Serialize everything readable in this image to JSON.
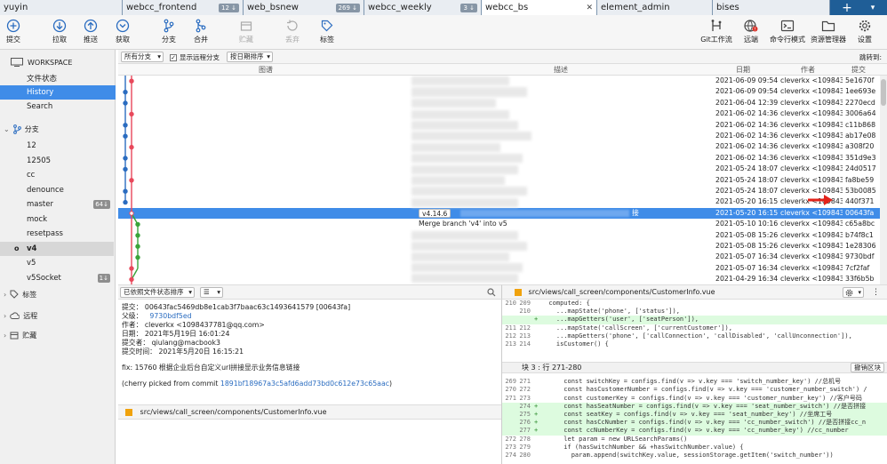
{
  "tabs": [
    {
      "label": "yuyin",
      "badge": "",
      "active": false
    },
    {
      "label": "webcc_frontend",
      "badge": "12 ↓",
      "active": false
    },
    {
      "label": "web_bsnew",
      "badge": "269 ↓",
      "active": false
    },
    {
      "label": "webcc_weekly",
      "badge": "3 ↓",
      "active": false
    },
    {
      "label": "webcc_bs",
      "badge": "",
      "active": true,
      "close": "✕"
    },
    {
      "label": "element_admin",
      "badge": "",
      "active": false
    },
    {
      "label": "bises",
      "badge": "",
      "active": false
    }
  ],
  "tab_plus": "+",
  "tab_menu": "▾",
  "toolbar": {
    "commit": "提交",
    "pull": "拉取",
    "push": "推送",
    "fetch": "获取",
    "branch": "分支",
    "merge": "合并",
    "stash": "贮藏",
    "discard": "丢弃",
    "tag": "标签",
    "gitflow": "Git工作流",
    "remote": "远端",
    "terminal": "命令行模式",
    "explorer": "资源管理器",
    "settings": "设置"
  },
  "sidebar": {
    "workspace": "WORKSPACE",
    "items": [
      "文件状态",
      "History",
      "Search"
    ],
    "branches_header": "分支",
    "branches": [
      {
        "name": "12",
        "count": ""
      },
      {
        "name": "12505",
        "count": ""
      },
      {
        "name": "cc",
        "count": ""
      },
      {
        "name": "denounce",
        "count": ""
      },
      {
        "name": "master",
        "count": "64↓"
      },
      {
        "name": "mock",
        "count": ""
      },
      {
        "name": "resetpass",
        "count": ""
      },
      {
        "name": "v4",
        "count": "",
        "current": true
      },
      {
        "name": "v5",
        "count": ""
      },
      {
        "name": "v5Socket",
        "count": "1↓"
      }
    ],
    "tags": "标签",
    "remotes": "远程",
    "stashes": "贮藏"
  },
  "filter": {
    "all_branches": "所有分支",
    "show_remote": "显示远程分支",
    "sort": "按日期排序",
    "jump": "跳转到:"
  },
  "columns": {
    "graph": "图谱",
    "desc": "描述",
    "date": "日期",
    "author": "作者",
    "commit": "提交"
  },
  "commits": [
    {
      "date": "2021-06-09 09:54",
      "author": "cleverkx <109843",
      "hash": "5e1670f"
    },
    {
      "date": "2021-06-09 09:54",
      "author": "cleverkx <109843",
      "hash": "1ee693e"
    },
    {
      "date": "2021-06-04 12:39",
      "author": "cleverkx <109843",
      "hash": "2270ecd"
    },
    {
      "date": "2021-06-02 14:36",
      "author": "cleverkx <109843",
      "hash": "3006a64"
    },
    {
      "date": "2021-06-02 14:36",
      "author": "cleverkx <109843",
      "hash": "c11b868"
    },
    {
      "date": "2021-06-02 14:36",
      "author": "cleverkx <109843",
      "hash": "ab17e08"
    },
    {
      "date": "2021-06-02 14:36",
      "author": "cleverkx <109843",
      "hash": "a308f20"
    },
    {
      "date": "2021-06-02 14:36",
      "author": "cleverkx <109843",
      "hash": "351d9e3"
    },
    {
      "date": "2021-05-24 18:07",
      "author": "cleverkx <109843",
      "hash": "24d0517"
    },
    {
      "date": "2021-05-24 18:07",
      "author": "cleverkx <109843",
      "hash": "fa8be59"
    },
    {
      "date": "2021-05-24 18:07",
      "author": "cleverkx <109843",
      "hash": "53b0085"
    },
    {
      "date": "2021-05-20 16:15",
      "author": "cleverkx <109843",
      "hash": "440f371"
    },
    {
      "date": "2021-05-20 16:15",
      "author": "cleverkx <109843",
      "hash": "00643fa",
      "selected": true,
      "tag": "v4.14.6",
      "suffix": "接"
    },
    {
      "date": "2021-05-10 10:16",
      "author": "cleverkx <109843",
      "hash": "c65a8bc",
      "desc": "Merge branch 'v4' into v5"
    },
    {
      "date": "2021-05-08 15:26",
      "author": "cleverkx <109843",
      "hash": "b74f8c1"
    },
    {
      "date": "2021-05-08 15:26",
      "author": "cleverkx <109843",
      "hash": "1e28306"
    },
    {
      "date": "2021-05-07 16:34",
      "author": "cleverkx <109843",
      "hash": "9730bdf"
    },
    {
      "date": "2021-05-07 16:34",
      "author": "cleverkx <109843",
      "hash": "7cf2faf"
    },
    {
      "date": "2021-04-29 16:34",
      "author": "cleverkx <109843",
      "hash": "33f6b5b"
    }
  ],
  "bottom_bar": {
    "sort": "已依照文件状态排序",
    "view": "☰"
  },
  "details": {
    "commit_line": "提交：  00643fac5469db8e1cab3f7baac63c1493641579 [00643fa]",
    "parent_label": "父级：",
    "parent_hash": "9730bdf5ed",
    "author_line": "作者：  cleverkx <1098437781@qq.com>",
    "date_line": "日期：  2021年5月19日 16:01:24",
    "committer_line": "提交者：  qiulang@macbook3",
    "commit_date_line": "提交时间：  2021年5月20日 16:15:21",
    "message": "fix: 15760 根据企业后台自定义url拼接显示业务信息链接",
    "cherry_prefix": "(cherry picked from commit ",
    "cherry_hash": "1891bf18967a3c5afd6add73bd0c612e73c65aac",
    "cherry_suffix": ")"
  },
  "file_path": "src/views/call_screen/components/CustomerInfo.vue",
  "diff": {
    "path": "src/views/call_screen/components/CustomerInfo.vue",
    "hunk1_lines": [
      {
        "n1": "210",
        "n2": "209",
        "mk": "",
        "code": "  computed: {",
        "add": false
      },
      {
        "n1": "",
        "n2": "210",
        "mk": "",
        "code": "    ...mapState('phone', ['status']),",
        "add": false
      },
      {
        "n1": "",
        "n2": "",
        "mk": "+",
        "code": "    ...mapGetters('user', ['seatPerson']),",
        "add": true
      },
      {
        "n1": "211",
        "n2": "212",
        "mk": "",
        "code": "    ...mapState('callScreen', ['currentCustomer']),",
        "add": false
      },
      {
        "n1": "212",
        "n2": "213",
        "mk": "",
        "code": "    ...mapGetters('phone', ['callConnection', 'callDisabled', 'callUnconnection']),",
        "add": false
      },
      {
        "n1": "213",
        "n2": "214",
        "mk": "",
        "code": "    isCustomer() {",
        "add": false
      }
    ],
    "hunk2_label": "块 3 : 行 271-280",
    "hunk2_button": "撤销区块",
    "hunk2_lines": [
      {
        "n1": "269",
        "n2": "271",
        "mk": "",
        "code": "      const switchKey = configs.find(v => v.key === 'switch_number_key') //总机号",
        "add": false
      },
      {
        "n1": "270",
        "n2": "272",
        "mk": "",
        "code": "      const hasCustomerNumber = configs.find(v => v.key === 'customer_number_switch') /",
        "add": false
      },
      {
        "n1": "271",
        "n2": "273",
        "mk": "",
        "code": "      const customerKey = configs.find(v => v.key === 'customer_number_key') //客户号码",
        "add": false
      },
      {
        "n1": "",
        "n2": "274",
        "mk": "+",
        "code": "      const hasSeatNumber = configs.find(v => v.key === 'seat_number_switch') //是否拼接",
        "add": true
      },
      {
        "n1": "",
        "n2": "275",
        "mk": "+",
        "code": "      const seatKey = configs.find(v => v.key === 'seat_number_key') //坐席工号",
        "add": true
      },
      {
        "n1": "",
        "n2": "276",
        "mk": "+",
        "code": "      const hasCcNumber = configs.find(v => v.key === 'cc_number_switch') //是否拼接cc_n",
        "add": true
      },
      {
        "n1": "",
        "n2": "277",
        "mk": "+",
        "code": "      const ccNumberKey = configs.find(v => v.key === 'cc_number_key') //cc_number",
        "add": true
      },
      {
        "n1": "272",
        "n2": "278",
        "mk": "",
        "code": "      let param = new URLSearchParams()",
        "add": false
      },
      {
        "n1": "273",
        "n2": "279",
        "mk": "",
        "code": "      if (hasSwitchNumber && +hasSwitchNumber.value) {",
        "add": false
      },
      {
        "n1": "274",
        "n2": "280",
        "mk": "",
        "code": "        param.append(switchKey.value, sessionStorage.getItem('switch_number'))",
        "add": false
      }
    ]
  },
  "colors": {
    "accent": "#3f8ce8",
    "tabbar": "#1f5e97",
    "graph_blue": "#2a6cc0",
    "graph_red": "#e8485b",
    "graph_green": "#3aa33a",
    "add_bg": "#ddfbdf"
  }
}
